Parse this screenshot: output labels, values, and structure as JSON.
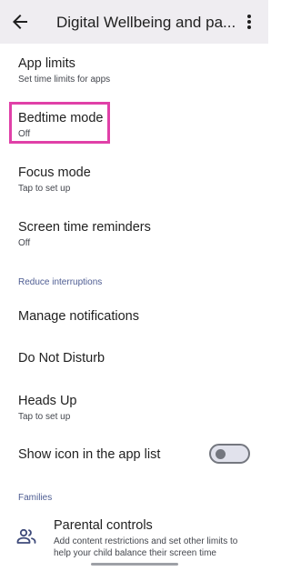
{
  "header": {
    "title": "Digital Wellbeing and pa...",
    "back_icon": "arrow-back-icon",
    "more_icon": "more-vert-icon"
  },
  "items": {
    "app_limits": {
      "title": "App limits",
      "subtitle": "Set time limits for apps"
    },
    "bedtime_mode": {
      "title": "Bedtime mode",
      "subtitle": "Off"
    },
    "focus_mode": {
      "title": "Focus mode",
      "subtitle": "Tap to set up"
    },
    "screen_time_reminders": {
      "title": "Screen time reminders",
      "subtitle": "Off"
    },
    "manage_notifications": {
      "title": "Manage notifications"
    },
    "do_not_disturb": {
      "title": "Do Not Disturb"
    },
    "heads_up": {
      "title": "Heads Up",
      "subtitle": "Tap to set up"
    },
    "show_icon": {
      "title": "Show icon in the app list",
      "toggle_on": false
    },
    "parental_controls": {
      "title": "Parental controls",
      "subtitle_line1": "Add content restrictions and set other limits to",
      "subtitle_line2": "help your child balance their screen time",
      "icon": "family-icon"
    }
  },
  "sections": {
    "reduce_interruptions": "Reduce interruptions",
    "families": "Families"
  },
  "colors": {
    "accent": "#4d5c92",
    "highlight": "#e040a8",
    "header_bg": "#efedf1"
  }
}
